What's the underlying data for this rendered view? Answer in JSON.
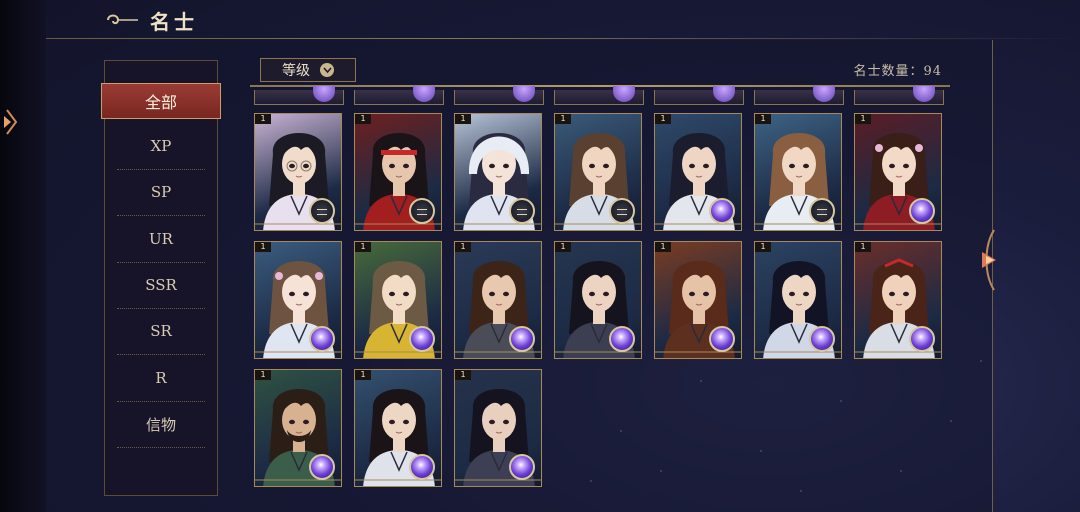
{
  "header": {
    "title": "名士"
  },
  "sidebar": {
    "items": [
      {
        "label": "全部",
        "active": true
      },
      {
        "label": "XP"
      },
      {
        "label": "SP"
      },
      {
        "label": "UR"
      },
      {
        "label": "SSR"
      },
      {
        "label": "SR"
      },
      {
        "label": "R"
      },
      {
        "label": "信物"
      }
    ]
  },
  "toolbar": {
    "sort_label": "等级",
    "count_text": "名士数量：94"
  },
  "cards": [
    {
      "num": "1",
      "orb": "compass",
      "hair": "#1c1a24",
      "skin": "#f1dccb",
      "robe": "#e8e0ee",
      "bg": "#c9b3d3",
      "accent": "glasses"
    },
    {
      "num": "1",
      "orb": "compass",
      "hair": "#1a1418",
      "skin": "#e6c7ad",
      "robe": "#a31e1e",
      "bg": "#6d2020",
      "accent": "headband"
    },
    {
      "num": "1",
      "orb": "compass",
      "hair": "#2a2a40",
      "skin": "#f3e3d8",
      "robe": "#dfe4f0",
      "bg": "#b7c3d6",
      "accent": "hood"
    },
    {
      "num": "1",
      "orb": "compass",
      "hair": "#5a4030",
      "skin": "#f0d6c0",
      "robe": "#d6dde6",
      "bg": "#3a5a78",
      "accent": ""
    },
    {
      "num": "1",
      "orb": "purple",
      "hair": "#1b1d2e",
      "skin": "#eed5c4",
      "robe": "#e4e6ee",
      "bg": "#2f4a6a",
      "accent": ""
    },
    {
      "num": "1",
      "orb": "compass",
      "hair": "#8a5e40",
      "skin": "#f1d8c4",
      "robe": "#e8ecf3",
      "bg": "#3e6384",
      "accent": ""
    },
    {
      "num": "1",
      "orb": "purple",
      "hair": "#3a1e18",
      "skin": "#f2d9c8",
      "robe": "#8e1c24",
      "bg": "#5a1d25",
      "accent": "flowers"
    },
    {
      "num": "1",
      "orb": "purple",
      "hair": "#6e5440",
      "skin": "#f6e2d6",
      "robe": "#dfe6f2",
      "bg": "#3b5c7e",
      "accent": "flowers"
    },
    {
      "num": "1",
      "orb": "purple",
      "hair": "#6d5a44",
      "skin": "#f2dcc6",
      "robe": "#d7b431",
      "bg": "#476a3a",
      "accent": ""
    },
    {
      "num": "1",
      "orb": "purple",
      "hair": "#3d2418",
      "skin": "#e8c8ae",
      "robe": "#4a4d58",
      "bg": "#2b3a56",
      "accent": ""
    },
    {
      "num": "1",
      "orb": "purple",
      "hair": "#15131d",
      "skin": "#ecd3c2",
      "robe": "#3c3e52",
      "bg": "#26364f",
      "accent": ""
    },
    {
      "num": "1",
      "orb": "purple",
      "hair": "#5a2a1a",
      "skin": "#e6c2a6",
      "robe": "#5c2f1e",
      "bg": "#7a3c22",
      "accent": ""
    },
    {
      "num": "1",
      "orb": "purple",
      "hair": "#121426",
      "skin": "#eed6c4",
      "robe": "#d0d8e8",
      "bg": "#2c4362",
      "accent": ""
    },
    {
      "num": "1",
      "orb": "purple",
      "hair": "#4a2418",
      "skin": "#f0d2bc",
      "robe": "#d8dde6",
      "bg": "#6a2e2a",
      "accent": "ribbon"
    },
    {
      "num": "1",
      "orb": "purple",
      "hair": "#2a1e16",
      "skin": "#d8b290",
      "robe": "#3a5e4a",
      "bg": "#2f5242",
      "accent": "beard"
    },
    {
      "num": "1",
      "orb": "purple",
      "hair": "#1a1418",
      "skin": "#eed6c4",
      "robe": "#dfe2ea",
      "bg": "#34506e",
      "accent": ""
    },
    {
      "num": "1",
      "orb": "purple",
      "hair": "#161320",
      "skin": "#e9cfbd",
      "robe": "#3d4054",
      "bg": "#26324a",
      "accent": ""
    }
  ]
}
